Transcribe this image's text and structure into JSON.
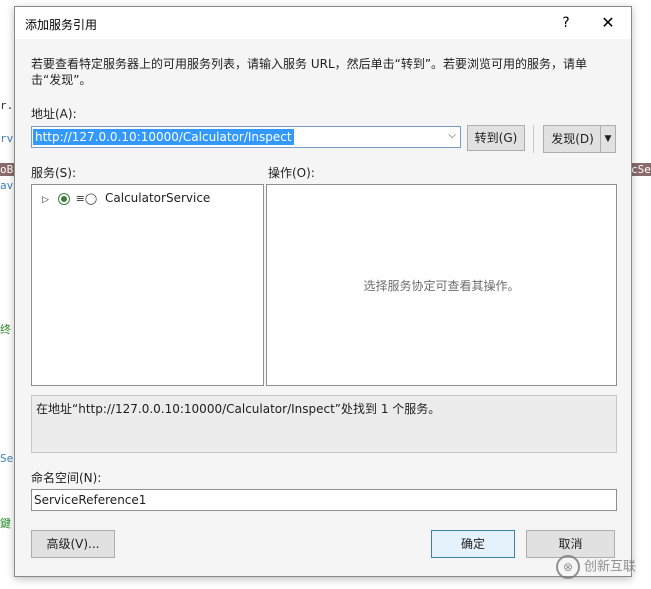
{
  "background": {
    "line1": "r.I",
    "line2": "rv:",
    "line3": "oBi",
    "line4": "avi",
    "line5": "终",
    "line6": "Se",
    "line7": "鍵",
    "right_highlight": "cSe"
  },
  "dialog": {
    "title": "添加服务引用",
    "help_icon": "?",
    "close_icon": "✕",
    "description": "若要查看特定服务器上的可用服务列表，请输入服务 URL，然后单击“转到”。若要浏览可用的服务，请单击“发现”。"
  },
  "address": {
    "label": "地址(A):",
    "value": "http://127.0.0.10:10000/Calculator/Inspect",
    "go_label": "转到(G)",
    "discover_label": "发现(D)"
  },
  "services": {
    "label": "服务(S):",
    "items": [
      {
        "label": "CalculatorService"
      }
    ]
  },
  "operations": {
    "label": "操作(O):",
    "hint": "选择服务协定可查看其操作。"
  },
  "status": {
    "text": "在地址“http://127.0.0.10:10000/Calculator/Inspect”处找到 1 个服务。"
  },
  "namespace": {
    "label": "命名空间(N):",
    "value": "ServiceReference1"
  },
  "buttons": {
    "advanced": "高级(V)...",
    "ok": "确定",
    "cancel": "取消"
  },
  "watermark": {
    "text": "创新互联"
  }
}
